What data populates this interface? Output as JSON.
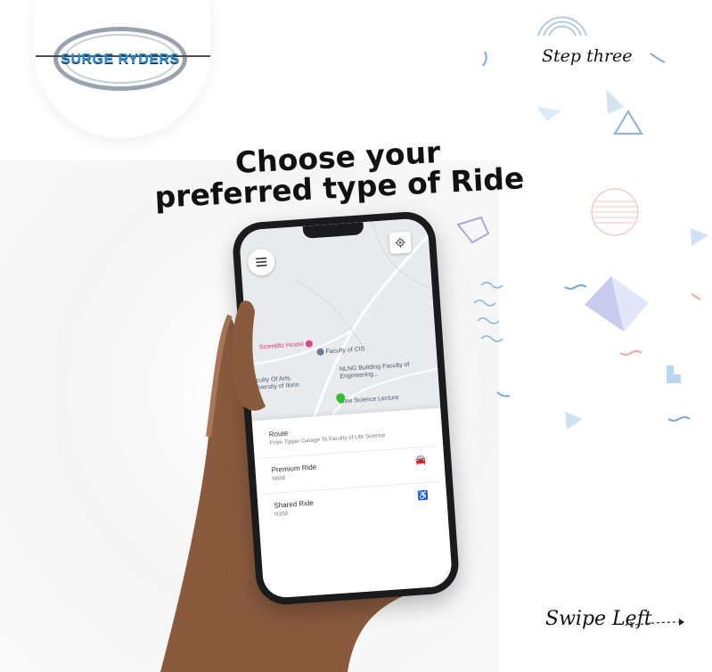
{
  "brand": {
    "logo_text": "SURGE RYDERS"
  },
  "step_label": "Step three",
  "heading": {
    "line1": "Choose your",
    "line2": "preferred type of Ride"
  },
  "map": {
    "pois": [
      {
        "label": "Scientific Hostel"
      },
      {
        "label": "Faculty of CIS"
      },
      {
        "label": "Faculty Of Arts, University of Ilorin"
      },
      {
        "label": "NLNG Building Faculty of Engineering..."
      },
      {
        "label": "New Science Lecture"
      }
    ]
  },
  "sheet": {
    "route_title": "Route",
    "route_detail": "From Tipper Garage To Faculty of Life Science",
    "options": [
      {
        "name": "Premium Ride",
        "price": "N600",
        "icon": "car-icon"
      },
      {
        "name": "Shared Ride",
        "price": "N150",
        "icon": "accessible-icon"
      }
    ]
  },
  "swipe_label": "Swipe Left",
  "colors": {
    "accent_blue": "#2f8fd0",
    "pin_green": "#2fbf2f",
    "poi_pink": "#d23f7a",
    "text_dark": "#111111"
  }
}
